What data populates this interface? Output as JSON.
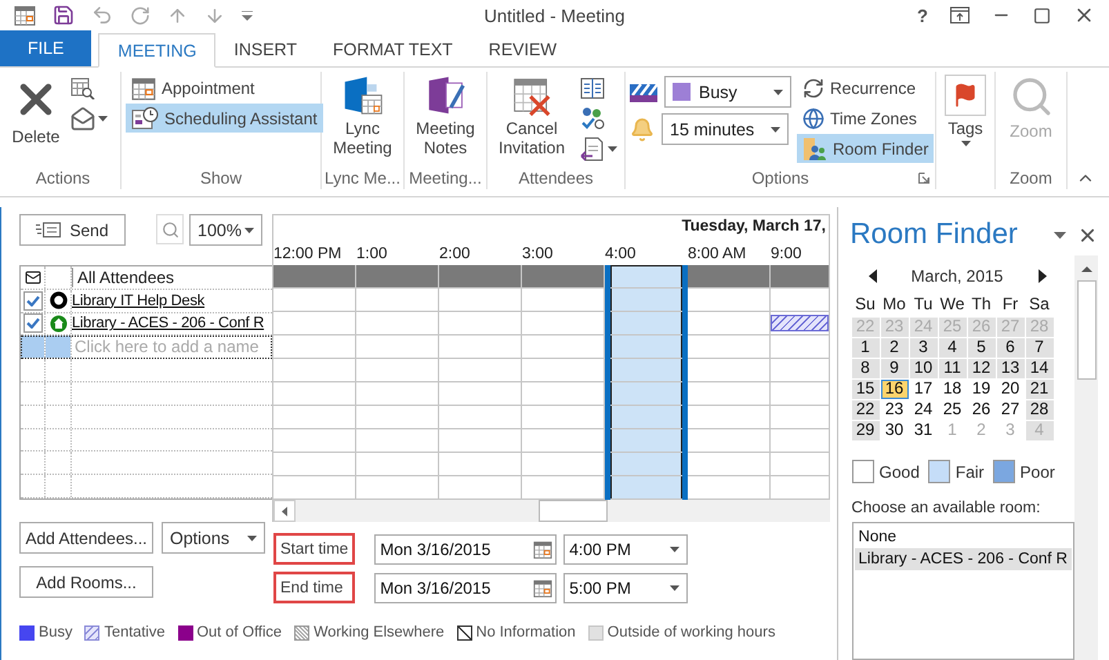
{
  "window": {
    "title": "Untitled - Meeting",
    "help": "?"
  },
  "tabs": [
    {
      "label": "FILE",
      "kind": "file",
      "selected": false
    },
    {
      "label": "MEETING",
      "kind": "tab",
      "selected": true
    },
    {
      "label": "INSERT",
      "kind": "tab",
      "selected": false
    },
    {
      "label": "FORMAT TEXT",
      "kind": "tab",
      "selected": false
    },
    {
      "label": "REVIEW",
      "kind": "tab",
      "selected": false
    }
  ],
  "ribbon": {
    "groups": [
      {
        "label": "Actions",
        "kind": "actions",
        "buttons": [
          {
            "label": "Delete"
          }
        ]
      },
      {
        "label": "Show",
        "kind": "show",
        "buttons": [
          {
            "label": "Appointment",
            "selected": false
          },
          {
            "label": "Scheduling Assistant",
            "selected": true
          }
        ]
      },
      {
        "label": "Lync Me...",
        "kind": "lync",
        "buttons": [
          {
            "label": "Lync Meeting"
          }
        ]
      },
      {
        "label": "Meeting...",
        "kind": "notes",
        "buttons": [
          {
            "label": "Meeting Notes"
          }
        ]
      },
      {
        "label": "Attendees",
        "kind": "attendees",
        "buttons": [
          {
            "label": "Cancel Invitation"
          }
        ]
      },
      {
        "label": "Options",
        "kind": "options",
        "show_as": "Busy",
        "reminder": "15 minutes",
        "buttons": [
          {
            "label": "Recurrence",
            "selected": false
          },
          {
            "label": "Time Zones",
            "selected": false
          },
          {
            "label": "Room Finder",
            "selected": true
          }
        ]
      },
      {
        "kind": "tags",
        "buttons": [
          {
            "label": "Tags"
          }
        ]
      },
      {
        "label": "Zoom",
        "kind": "zoom",
        "buttons": [
          {
            "label": "Zoom",
            "disabled": true
          }
        ]
      }
    ]
  },
  "scheduler": {
    "send": "Send",
    "zoom_level": "100%",
    "day_heading": "Tuesday, March 17,",
    "columns": [
      {
        "label": "12:00 PM",
        "selected": false
      },
      {
        "label": "1:00",
        "selected": false
      },
      {
        "label": "2:00",
        "selected": false
      },
      {
        "label": "3:00",
        "selected": false
      },
      {
        "label": "4:00",
        "selected": true
      },
      {
        "label": "8:00 AM",
        "selected": false
      },
      {
        "label": "9:00",
        "selected": false
      }
    ],
    "attendee_header": "All Attendees",
    "attendees": [
      {
        "name": "Library IT Help Desk",
        "kind": "person",
        "checked": true,
        "schedule": [
          {
            "kind": "free"
          },
          {
            "kind": "free"
          },
          {
            "kind": "free"
          },
          {
            "kind": "free"
          },
          {
            "kind": "free"
          },
          {
            "kind": "free"
          },
          {
            "kind": "free"
          }
        ]
      },
      {
        "name": "Library - ACES - 206 - Conf R",
        "kind": "room",
        "checked": true,
        "schedule": [
          {
            "kind": "free"
          },
          {
            "kind": "free"
          },
          {
            "kind": "free"
          },
          {
            "kind": "free"
          },
          {
            "kind": "free"
          },
          {
            "kind": "free"
          },
          {
            "kind": "tentative"
          }
        ]
      }
    ],
    "add_placeholder": "Click here to add a name",
    "add_attendees": "Add Attendees...",
    "options": "Options",
    "add_rooms": "Add Rooms...",
    "times": [
      {
        "label": "Start time",
        "date": "Mon 3/16/2015",
        "time": "4:00 PM"
      },
      {
        "label": "End time",
        "date": "Mon 3/16/2015",
        "time": "5:00 PM"
      }
    ],
    "legend": [
      {
        "label": "Busy",
        "kind": "busy"
      },
      {
        "label": "Tentative",
        "kind": "tentative"
      },
      {
        "label": "Out of Office",
        "kind": "out_of_office"
      },
      {
        "label": "Working Elsewhere",
        "kind": "elsewhere"
      },
      {
        "label": "No Information",
        "kind": "no_info"
      },
      {
        "label": "Outside of working hours",
        "kind": "outside_hours"
      }
    ]
  },
  "room_finder": {
    "title": "Room Finder",
    "month": "March, 2015",
    "weekdays": [
      "Su",
      "Mo",
      "Tu",
      "We",
      "Th",
      "Fr",
      "Sa"
    ],
    "weeks": [
      [
        {
          "day": "22",
          "outside": true,
          "shaded": true,
          "selected": false
        },
        {
          "day": "23",
          "outside": true,
          "shaded": true,
          "selected": false
        },
        {
          "day": "24",
          "outside": true,
          "shaded": true,
          "selected": false
        },
        {
          "day": "25",
          "outside": true,
          "shaded": true,
          "selected": false
        },
        {
          "day": "26",
          "outside": true,
          "shaded": true,
          "selected": false
        },
        {
          "day": "27",
          "outside": true,
          "shaded": true,
          "selected": false
        },
        {
          "day": "28",
          "outside": true,
          "shaded": true,
          "selected": false
        }
      ],
      [
        {
          "day": "1",
          "outside": false,
          "shaded": true,
          "selected": false
        },
        {
          "day": "2",
          "outside": false,
          "shaded": true,
          "selected": false
        },
        {
          "day": "3",
          "outside": false,
          "shaded": true,
          "selected": false
        },
        {
          "day": "4",
          "outside": false,
          "shaded": true,
          "selected": false
        },
        {
          "day": "5",
          "outside": false,
          "shaded": true,
          "selected": false
        },
        {
          "day": "6",
          "outside": false,
          "shaded": true,
          "selected": false
        },
        {
          "day": "7",
          "outside": false,
          "shaded": true,
          "selected": false
        }
      ],
      [
        {
          "day": "8",
          "outside": false,
          "shaded": true,
          "selected": false
        },
        {
          "day": "9",
          "outside": false,
          "shaded": true,
          "selected": false
        },
        {
          "day": "10",
          "outside": false,
          "shaded": true,
          "selected": false
        },
        {
          "day": "11",
          "outside": false,
          "shaded": true,
          "selected": false
        },
        {
          "day": "12",
          "outside": false,
          "shaded": true,
          "selected": false
        },
        {
          "day": "13",
          "outside": false,
          "shaded": true,
          "selected": false
        },
        {
          "day": "14",
          "outside": false,
          "shaded": true,
          "selected": false
        }
      ],
      [
        {
          "day": "15",
          "outside": false,
          "shaded": true,
          "selected": false
        },
        {
          "day": "16",
          "outside": false,
          "shaded": false,
          "selected": true
        },
        {
          "day": "17",
          "outside": false,
          "shaded": false,
          "selected": false
        },
        {
          "day": "18",
          "outside": false,
          "shaded": false,
          "selected": false
        },
        {
          "day": "19",
          "outside": false,
          "shaded": false,
          "selected": false
        },
        {
          "day": "20",
          "outside": false,
          "shaded": false,
          "selected": false
        },
        {
          "day": "21",
          "outside": false,
          "shaded": true,
          "selected": false
        }
      ],
      [
        {
          "day": "22",
          "outside": false,
          "shaded": true,
          "selected": false
        },
        {
          "day": "23",
          "outside": false,
          "shaded": false,
          "selected": false
        },
        {
          "day": "24",
          "outside": false,
          "shaded": false,
          "selected": false
        },
        {
          "day": "25",
          "outside": false,
          "shaded": false,
          "selected": false
        },
        {
          "day": "26",
          "outside": false,
          "shaded": false,
          "selected": false
        },
        {
          "day": "27",
          "outside": false,
          "shaded": false,
          "selected": false
        },
        {
          "day": "28",
          "outside": false,
          "shaded": true,
          "selected": false
        }
      ],
      [
        {
          "day": "29",
          "outside": false,
          "shaded": true,
          "selected": false
        },
        {
          "day": "30",
          "outside": false,
          "shaded": false,
          "selected": false
        },
        {
          "day": "31",
          "outside": false,
          "shaded": false,
          "selected": false
        },
        {
          "day": "1",
          "outside": true,
          "shaded": false,
          "selected": false
        },
        {
          "day": "2",
          "outside": true,
          "shaded": false,
          "selected": false
        },
        {
          "day": "3",
          "outside": true,
          "shaded": false,
          "selected": false
        },
        {
          "day": "4",
          "outside": true,
          "shaded": true,
          "selected": false
        }
      ]
    ],
    "quality": [
      {
        "label": "Good",
        "color": "#ffffff"
      },
      {
        "label": "Fair",
        "color": "#c5ddf8"
      },
      {
        "label": "Poor",
        "color": "#7ba7e0"
      }
    ],
    "rooms_label": "Choose an available room:",
    "rooms": [
      {
        "label": "None",
        "selected": false
      },
      {
        "label": "Library - ACES - 206 - Conf R",
        "selected": true
      }
    ]
  }
}
